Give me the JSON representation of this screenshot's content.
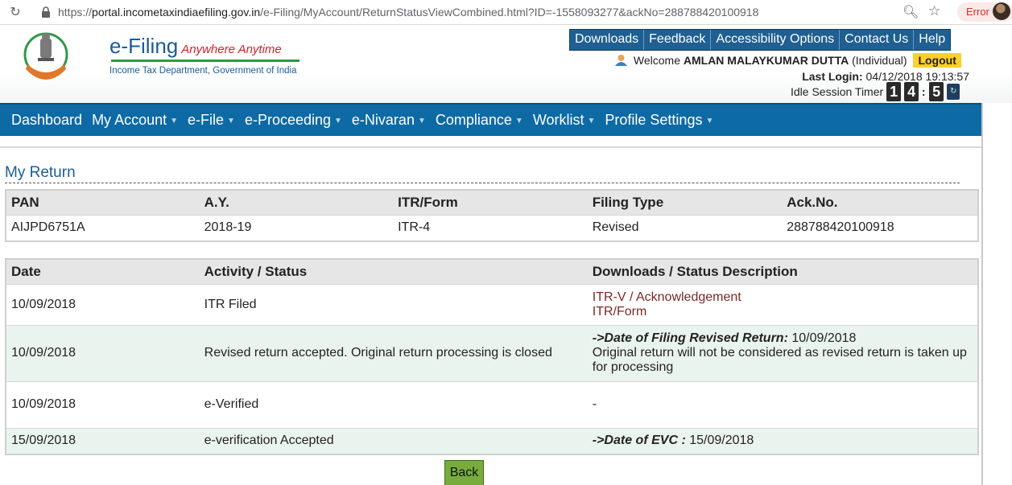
{
  "browser": {
    "url_scheme": "https://",
    "url_host": "portal.incometaxindiaefiling.gov.in",
    "url_path": "/e-Filing/MyAccount/ReturnStatusViewCombined.html?ID=-1558093277&ackNo=288788420100918",
    "error_label": "Error"
  },
  "header": {
    "brand_main": "e-Filing",
    "brand_tagline": "Anywhere Anytime",
    "department": "Income Tax Department, Government of India",
    "top_links": [
      "Downloads",
      "Feedback",
      "Accessibility Options",
      "Contact Us",
      "Help"
    ],
    "welcome_prefix": "Welcome",
    "user_name": "AMLAN MALAYKUMAR DUTTA",
    "user_type": "(Individual)",
    "logout_label": "Logout",
    "last_login_label": "Last Login:",
    "last_login_value": "04/12/2018 19:13:57",
    "idle_label": "Idle Session Timer",
    "timer_digits": [
      "1",
      "4",
      "5"
    ]
  },
  "nav": {
    "items": [
      "Dashboard",
      "My Account",
      "e-File",
      "e-Proceeding",
      "e-Nivaran",
      "Compliance",
      "Worklist",
      "Profile Settings"
    ]
  },
  "page": {
    "title": "My Return",
    "summary_headers": [
      "PAN",
      "A.Y.",
      "ITR/Form",
      "Filing Type",
      "Ack.No."
    ],
    "summary_row": [
      "AIJPD6751A",
      "2018-19",
      "ITR-4",
      "Revised",
      "288788420100918"
    ],
    "status_headers": [
      "Date",
      "Activity / Status",
      "Downloads / Status Description"
    ],
    "rows": [
      {
        "date": "10/09/2018",
        "activity": "ITR Filed",
        "link1": "ITR-V / Acknowledgement",
        "link2": "ITR/Form"
      },
      {
        "date": "10/09/2018",
        "activity": "Revised return accepted. Original return processing is closed",
        "desc_label": "->Date of Filing Revised Return:",
        "desc_value": " 10/09/2018",
        "desc_note": "Original return will not be considered as revised return is taken up for processing"
      },
      {
        "date": "10/09/2018",
        "activity": "e-Verified",
        "desc": "-"
      },
      {
        "date": "15/09/2018",
        "activity": "e-verification Accepted",
        "desc_label": "->Date of EVC :",
        "desc_value": " 15/09/2018"
      }
    ],
    "back_label": "Back"
  }
}
